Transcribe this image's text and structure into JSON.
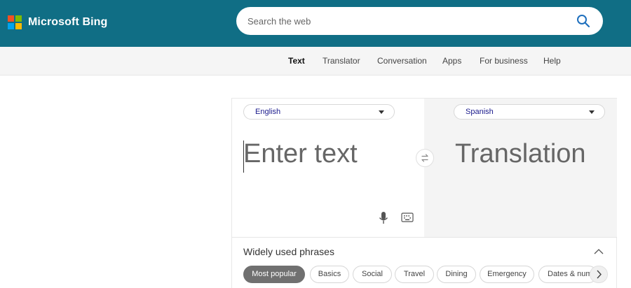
{
  "header": {
    "brand_name": "Microsoft Bing",
    "logo_colors": [
      "#f25022",
      "#7fba00",
      "#00a4ef",
      "#ffb900"
    ],
    "search": {
      "placeholder": "Search the web",
      "value": ""
    }
  },
  "nav": {
    "items": [
      "Text",
      "Translator",
      "Conversation",
      "Apps",
      "For business",
      "Help"
    ],
    "active": "Text"
  },
  "translator": {
    "source_language": "English",
    "target_language": "Spanish",
    "source_placeholder": "Enter text",
    "target_placeholder": "Translation",
    "icons": [
      "swap-icon",
      "microphone-icon",
      "keyboard-icon",
      "chevron-up-icon",
      "chevron-right-icon"
    ]
  },
  "phrases": {
    "title": "Widely used phrases",
    "categories": [
      "Most popular",
      "Basics",
      "Social",
      "Travel",
      "Dining",
      "Emergency",
      "Dates & numbers"
    ],
    "active": "Most popular"
  },
  "colors": {
    "header_bg": "#106e85",
    "nav_bg": "#f5f5f5",
    "language_text": "#1a1a8c",
    "active_chip": "#707070"
  }
}
